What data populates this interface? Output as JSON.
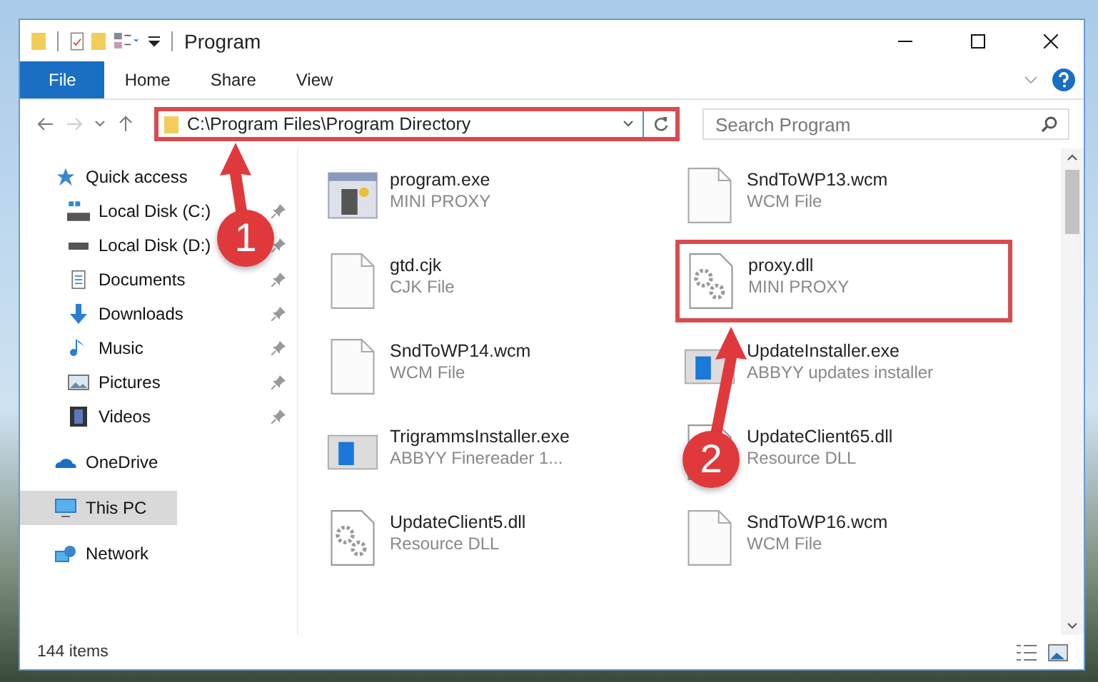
{
  "window": {
    "title": "Program"
  },
  "ribbon_tabs": [
    {
      "label": "File",
      "selected": true
    },
    {
      "label": "Home",
      "selected": false
    },
    {
      "label": "Share",
      "selected": false
    },
    {
      "label": "View",
      "selected": false
    }
  ],
  "address": {
    "path": "C:\\Program Files\\Program Directory",
    "highlighted": true
  },
  "search": {
    "placeholder": "Search Program"
  },
  "sidebar": {
    "items": [
      {
        "label": "Quick access",
        "kind": "quick",
        "selected": false,
        "children": [
          {
            "label": "Local Disk (C:)",
            "kind": "windisk",
            "selected": false,
            "pinned": true
          },
          {
            "label": "Local Disk (D:)",
            "kind": "disk",
            "selected": false,
            "pinned": true
          },
          {
            "label": "Documents",
            "kind": "documents",
            "selected": false,
            "pinned": true
          },
          {
            "label": "Downloads",
            "kind": "downloads",
            "selected": false,
            "pinned": true
          },
          {
            "label": "Music",
            "kind": "music",
            "selected": false,
            "pinned": true
          },
          {
            "label": "Pictures",
            "kind": "pictures",
            "selected": false,
            "pinned": true
          },
          {
            "label": "Videos",
            "kind": "videos",
            "selected": false,
            "pinned": true
          }
        ]
      },
      {
        "label": "OneDrive",
        "kind": "cloud",
        "selected": false
      },
      {
        "label": "This PC",
        "kind": "pc",
        "selected": true
      },
      {
        "label": "Network",
        "kind": "network",
        "selected": false
      }
    ]
  },
  "files": [
    {
      "name": "program.exe",
      "type": "MINI PROXY",
      "kind": "exe",
      "highlighted": false
    },
    {
      "name": "SndToWP13.wcm",
      "type": "WCM File",
      "kind": "blank",
      "highlighted": false
    },
    {
      "name": "gtd.cjk",
      "type": "CJK File",
      "kind": "blank",
      "highlighted": false
    },
    {
      "name": "proxy.dll",
      "type": "MINI PROXY",
      "kind": "dll",
      "highlighted": true
    },
    {
      "name": "SndToWP14.wcm",
      "type": "WCM File",
      "kind": "blank",
      "highlighted": false
    },
    {
      "name": "UpdateInstaller.exe",
      "type": "ABBYY updates installer",
      "kind": "installer",
      "highlighted": false
    },
    {
      "name": "TrigrammsInstaller.exe",
      "type": "ABBYY Finereader 1...",
      "kind": "installer",
      "highlighted": false
    },
    {
      "name": "UpdateClient65.dll",
      "type": "Resource DLL",
      "kind": "dll",
      "highlighted": false
    },
    {
      "name": "UpdateClient5.dll",
      "type": "Resource DLL",
      "kind": "dll",
      "highlighted": false
    },
    {
      "name": "SndToWP16.wcm",
      "type": "WCM File",
      "kind": "blank",
      "highlighted": false
    }
  ],
  "status_bar": {
    "count": "144 items"
  },
  "annotations": [
    {
      "number": "1"
    },
    {
      "number": "2"
    }
  ]
}
